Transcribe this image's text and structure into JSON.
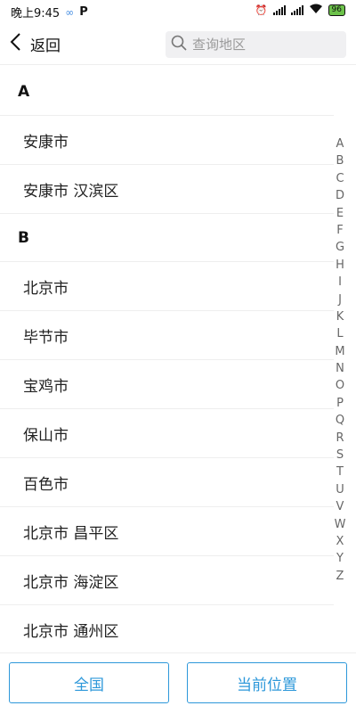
{
  "status_bar": {
    "time": "晚上9:45",
    "battery": "96",
    "icons": [
      "infinity-icon",
      "p-icon",
      "alarm-icon",
      "signal-icon",
      "signal-icon",
      "wifi-icon",
      "battery-icon"
    ]
  },
  "header": {
    "back_label": "返回",
    "search_placeholder": "查询地区"
  },
  "sections": [
    {
      "letter": "A",
      "items": [
        "安康市",
        "安康市 汉滨区"
      ]
    },
    {
      "letter": "B",
      "items": [
        "北京市",
        "毕节市",
        "宝鸡市",
        "保山市",
        "百色市",
        "北京市 昌平区",
        "北京市 海淀区",
        "北京市 通州区"
      ]
    }
  ],
  "alphabet": [
    "A",
    "B",
    "C",
    "D",
    "E",
    "F",
    "G",
    "H",
    "I",
    "J",
    "K",
    "L",
    "M",
    "N",
    "O",
    "P",
    "Q",
    "R",
    "S",
    "T",
    "U",
    "V",
    "W",
    "X",
    "Y",
    "Z"
  ],
  "bottom": {
    "left_label": "全国",
    "right_label": "当前位置"
  },
  "colors": {
    "accent": "#2d98da",
    "divider": "#eeeeee",
    "search_bg": "#f0f0f2"
  }
}
